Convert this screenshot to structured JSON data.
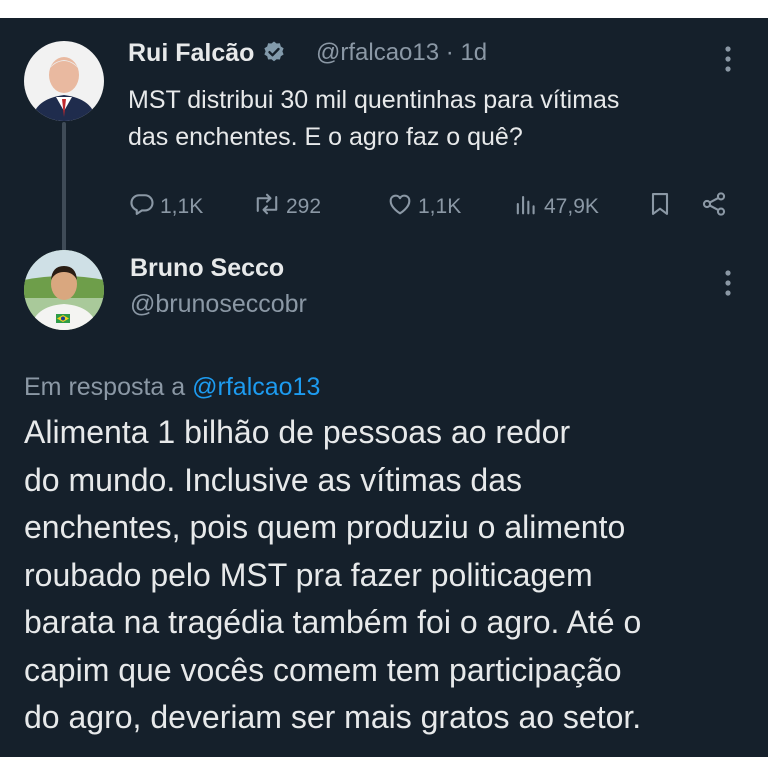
{
  "top_strip_text": "",
  "tweet1": {
    "display_name": "Rui Falcão",
    "handle": "@rfalcao13",
    "separator": "·",
    "time": "1d",
    "text_lines": [
      "MST distribui 30 mil quentinhas para vítimas",
      "das enchentes. E o agro faz o quê?"
    ],
    "actions": {
      "replies": "1,1K",
      "reposts": "292",
      "likes": "1,1K",
      "views": "47,9K"
    }
  },
  "tweet2": {
    "display_name": "Bruno Secco",
    "handle": "@brunoseccobr",
    "reply_prefix": "Em resposta a",
    "reply_to": "@rfalcao13",
    "text_lines": [
      "Alimenta 1 bilhão de pessoas ao redor",
      "do mundo. Inclusive as vítimas das",
      "enchentes, pois quem produziu o alimento",
      "roubado pelo MST pra fazer politicagem",
      "barata na tragédia também foi o agro. Até o",
      "capim que vocês comem tem participação",
      "do agro, deveriam ser mais gratos ao setor."
    ]
  },
  "icons": [
    "verified-badge-icon",
    "more-icon",
    "reply-icon",
    "repost-icon",
    "like-icon",
    "views-icon",
    "bookmark-icon",
    "share-icon"
  ],
  "colors": {
    "background": "#15202b",
    "text": "#e7e9ea",
    "muted": "#8b98a5",
    "link": "#1d9bf0",
    "verified": "#829aab"
  }
}
